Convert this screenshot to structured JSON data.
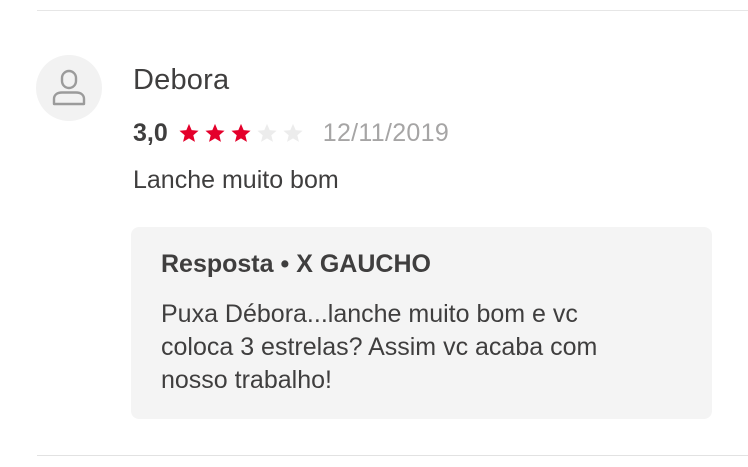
{
  "review": {
    "author": "Debora",
    "avatar_icon": "user-silhouette-icon",
    "rating_text": "3,0",
    "rating": 3,
    "max_rating": 5,
    "date": "12/11/2019",
    "text": "Lanche muito bom"
  },
  "reply": {
    "label": "Resposta",
    "separator": "•",
    "author": "X GAUCHO",
    "text": "Puxa Débora...lanche muito bom e vc\ncoloca 3 estrelas? Assim vc acaba com\nnosso trabalho!"
  },
  "colors": {
    "star_filled": "#e4002b",
    "star_empty": "#ececec",
    "text_primary": "#3f3e3e",
    "text_muted": "#a6a5a5",
    "reply_background": "#f4f4f4"
  }
}
